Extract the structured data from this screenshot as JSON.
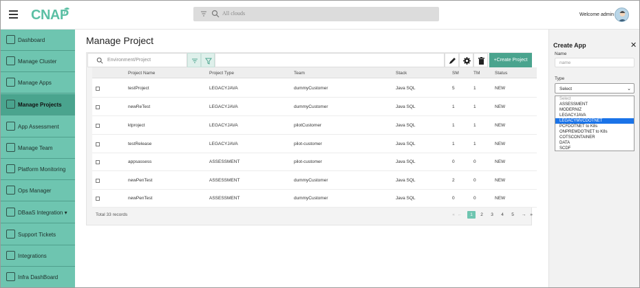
{
  "header": {
    "logo_text": "CNAP",
    "search_placeholder": "All clouds",
    "welcome": "Welcome admin"
  },
  "sidebar": {
    "items": [
      {
        "label": "Dashboard",
        "icon": "dashboard-icon"
      },
      {
        "label": "Manage Cluster",
        "icon": "cluster-icon"
      },
      {
        "label": "Manage Apps",
        "icon": "apps-icon"
      },
      {
        "label": "Manage Projects",
        "icon": "projects-icon",
        "active": true
      },
      {
        "label": "App Assessment",
        "icon": "assessment-icon"
      },
      {
        "label": "Manage Team",
        "icon": "team-icon"
      },
      {
        "label": "Platform Monitoring",
        "icon": "monitoring-icon"
      },
      {
        "label": "Ops Manager",
        "icon": "ops-icon"
      },
      {
        "label": "DBaaS Integration ▾",
        "icon": "database-icon"
      },
      {
        "label": "Support Tickets",
        "icon": "ticket-icon"
      },
      {
        "label": "Integrations",
        "icon": "integrations-icon"
      },
      {
        "label": "Infra DashBoard",
        "icon": "infra-icon"
      }
    ]
  },
  "main": {
    "title": "Manage Project",
    "search_placeholder": "Environment/Project",
    "create_label": "+Create Project",
    "columns": [
      "Project Name",
      "Project Type",
      "Team",
      "Stack",
      "SM",
      "TM",
      "Status"
    ],
    "rows": [
      [
        "testProject",
        "LEGACYJAVA",
        "dummyCustomer",
        "Java SQL",
        "5",
        "1",
        "NEW"
      ],
      [
        "newReTest",
        "LEGACYJAVA",
        "dummyCustomer",
        "Java SQL",
        "1",
        "1",
        "NEW"
      ],
      [
        "ktproject",
        "LEGACYJAVA",
        "pilotCustomer",
        "Java SQL",
        "1",
        "1",
        "NEW"
      ],
      [
        "testRelease",
        "LEGACYJAVA",
        "pilot-customer",
        "Java SQL",
        "1",
        "1",
        "NEW"
      ],
      [
        "appsassess",
        "ASSESSMENT",
        "pilot-customer",
        "Java SQL",
        "0",
        "0",
        "NEW"
      ],
      [
        "newPenTest",
        "ASSESSMENT",
        "dummyCustomer",
        "Java SQL",
        "2",
        "0",
        "NEW"
      ],
      [
        "newPenTest",
        "ASSESSMENT",
        "dummyCustomer",
        "Java SQL",
        "0",
        "0",
        "NEW"
      ]
    ],
    "total": "Total 33 records",
    "pager": {
      "first": "«",
      "prev": "←",
      "pages": [
        "1",
        "2",
        "3",
        "4",
        "5"
      ],
      "active": "1",
      "next": "→",
      "last": "»"
    }
  },
  "panel": {
    "title": "Create App",
    "close": "✕",
    "name_label": "Name",
    "name_placeholder": "name",
    "type_label": "Type",
    "type_value": "Select",
    "options": [
      "Select",
      "ASSESSMENT",
      "MODERNIZ",
      "LEGACYJAVA",
      "LEGACYMVCDOTNET",
      "PCFDOTNET to K8s",
      "ONPREMDOTNET to K8s",
      "COTSCONTAINER",
      "DATA",
      "SCDF"
    ],
    "selected_option": "LEGACYMVCDOTNET"
  },
  "colors": {
    "accent": "#6ec5b0",
    "accent_dark": "#4aa48e",
    "selected_blue": "#1a73e8"
  }
}
